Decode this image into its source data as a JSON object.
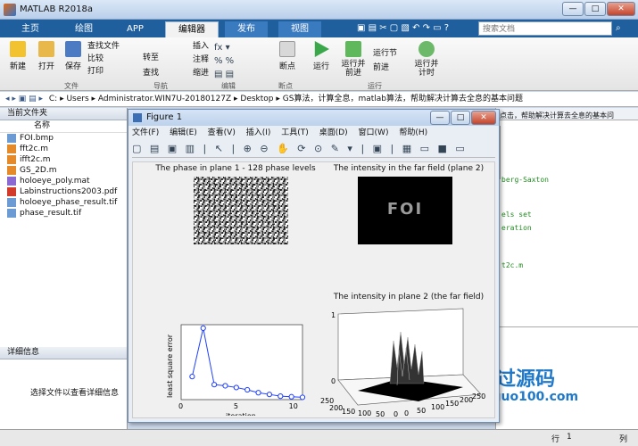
{
  "app": {
    "title": "MATLAB R2018a",
    "window_buttons": [
      "—",
      "□",
      "✕"
    ]
  },
  "tabs": [
    {
      "label": "主页"
    },
    {
      "label": "绘图"
    },
    {
      "label": "APP"
    },
    {
      "label": "编辑器"
    },
    {
      "label": "发布"
    },
    {
      "label": "视图"
    }
  ],
  "search": {
    "placeholder": "搜索文档"
  },
  "ribbon": {
    "file_buttons": [
      {
        "label": "新建",
        "icon": "new-icon"
      },
      {
        "label": "打开",
        "icon": "open-icon"
      },
      {
        "label": "保存",
        "icon": "save-icon"
      }
    ],
    "file_small": [
      "查找文件",
      "比较",
      "打印"
    ],
    "nav_small": [
      "转至",
      "查找"
    ],
    "edit_small": [
      "插入",
      "注释",
      "缩进"
    ],
    "breakpoint": "断点",
    "run_buttons": [
      "运行",
      "运行并前进",
      "运行节",
      "前进",
      "运行并计时"
    ],
    "groups": [
      "文件",
      "导航",
      "编辑",
      "断点",
      "运行"
    ]
  },
  "path": {
    "segments": [
      "C:",
      "Users",
      "Administrator.WIN7U-20180127Z",
      "Desktop",
      "GS算法，计算全息，matlab算法，帮助解决计算去全息的基本问题"
    ]
  },
  "left_panel": {
    "title": "当前文件夹",
    "col_header": "名称",
    "files": [
      {
        "name": "FOI.bmp",
        "kind": "image"
      },
      {
        "name": "fft2c.m",
        "kind": "m"
      },
      {
        "name": "ifft2c.m",
        "kind": "m"
      },
      {
        "name": "GS_2D.m",
        "kind": "m"
      },
      {
        "name": "holoeye_poly.mat",
        "kind": "mat"
      },
      {
        "name": "Labinstructions2003.pdf",
        "kind": "pdf"
      },
      {
        "name": "holoeye_phase_result.tif",
        "kind": "image"
      },
      {
        "name": "phase_result.tif",
        "kind": "image"
      }
    ],
    "details_title": "详细信息",
    "details_hint": "选择文件以查看详细信息"
  },
  "right_panel": {
    "lines": [
      "点击，帮助解决计算去全息的基本问",
      "berg-Saxton",
      "els set",
      "eration",
      "t2c.m"
    ]
  },
  "status": {
    "row_label": "行",
    "row": "1",
    "col_label": "列"
  },
  "watermark": {
    "brand": "必过源码",
    "url": "Biguo100.com"
  },
  "figure": {
    "title": "Figure 1",
    "menu": [
      "文件(F)",
      "编辑(E)",
      "查看(V)",
      "插入(I)",
      "工具(T)",
      "桌面(D)",
      "窗口(W)",
      "帮助(H)"
    ],
    "ax1_title": "The phase in plane 1 - 128 phase levels",
    "ax2_title": "The intensity in the far field (plane 2)",
    "ax2_text": "FOI",
    "ax3_title": "",
    "ax4_title": "The intensity in plane 2 (the far field)",
    "ax4_ticks": {
      "z": [
        "0",
        "1"
      ],
      "x": [
        "0",
        "50",
        "100",
        "150",
        "200",
        "250"
      ],
      "y": [
        "0",
        "50",
        "100",
        "150",
        "200",
        "250"
      ]
    }
  },
  "chart_data": {
    "type": "line",
    "title": "",
    "xlabel": "iteration",
    "ylabel": "least square error",
    "x": [
      1,
      2,
      3,
      4,
      5,
      6,
      7,
      8,
      9,
      10,
      11
    ],
    "y": [
      0.2,
      0.62,
      0.13,
      0.12,
      0.105,
      0.085,
      0.06,
      0.045,
      0.03,
      0.025,
      0.02
    ],
    "xlim": [
      0,
      11
    ],
    "ylim": [
      0,
      0.65
    ],
    "xticks": [
      "0",
      "5",
      "10"
    ],
    "color": "#1f3fff",
    "marker": "circle"
  }
}
